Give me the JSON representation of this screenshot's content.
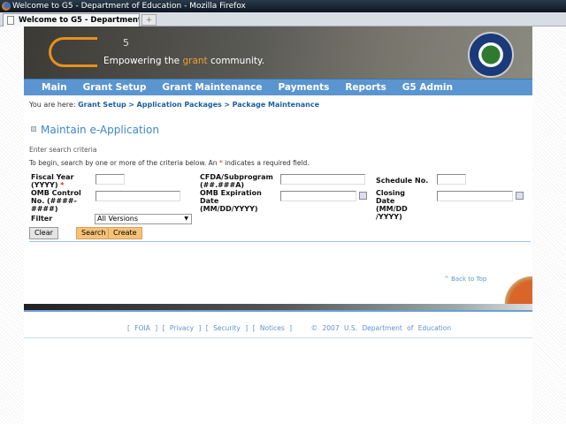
{
  "window": {
    "title": "Welcome to G5 - Department of Education - Mozilla Firefox",
    "tab_label": "Welcome to G5 - Department of Edu..."
  },
  "banner": {
    "logo": "G5",
    "tagline_pre": "Empowering the ",
    "tagline_accent": "grant",
    "tagline_post": " community.",
    "seal": "Department of Education seal"
  },
  "nav": [
    "Main",
    "Grant Setup",
    "Grant Maintenance",
    "Payments",
    "Reports",
    "G5 Admin"
  ],
  "breadcrumb": {
    "prefix": "You are here:",
    "items": [
      "Grant Setup",
      "Application Packages",
      "Package Maintenance"
    ]
  },
  "page_title": "Maintain e-Application",
  "subtitle": "Enter search criteria",
  "instructions": {
    "pre": "To begin, search by one or more of the criteria below. An ",
    "star": "*",
    "post": " indicates a required field."
  },
  "fields": {
    "fiscal_year": {
      "label": "Fiscal Year (YYYY)",
      "required": "*",
      "value": ""
    },
    "cfda": {
      "label": "CFDA/Subprogram (##.###A)",
      "value": ""
    },
    "schedule": {
      "label": "Schedule No.",
      "value": ""
    },
    "omb_control": {
      "label": "OMB Control No. (####-####)",
      "value": ""
    },
    "omb_expiration": {
      "label": "OMB Expiration Date (MM/DD/YYYY)",
      "value": ""
    },
    "closing_date": {
      "label": "Closing Date (MM/DD /YYYY)",
      "value": ""
    },
    "filter": {
      "label": "Filter",
      "value": "All Versions"
    }
  },
  "buttons": {
    "clear": "Clear",
    "search": "Search",
    "create": "Create"
  },
  "back_to_top": "^ Back to Top",
  "footer": {
    "links": [
      "FOIA",
      "Privacy",
      "Security",
      "Notices"
    ],
    "copyright": "© 2007 U.S. Department of Education"
  }
}
